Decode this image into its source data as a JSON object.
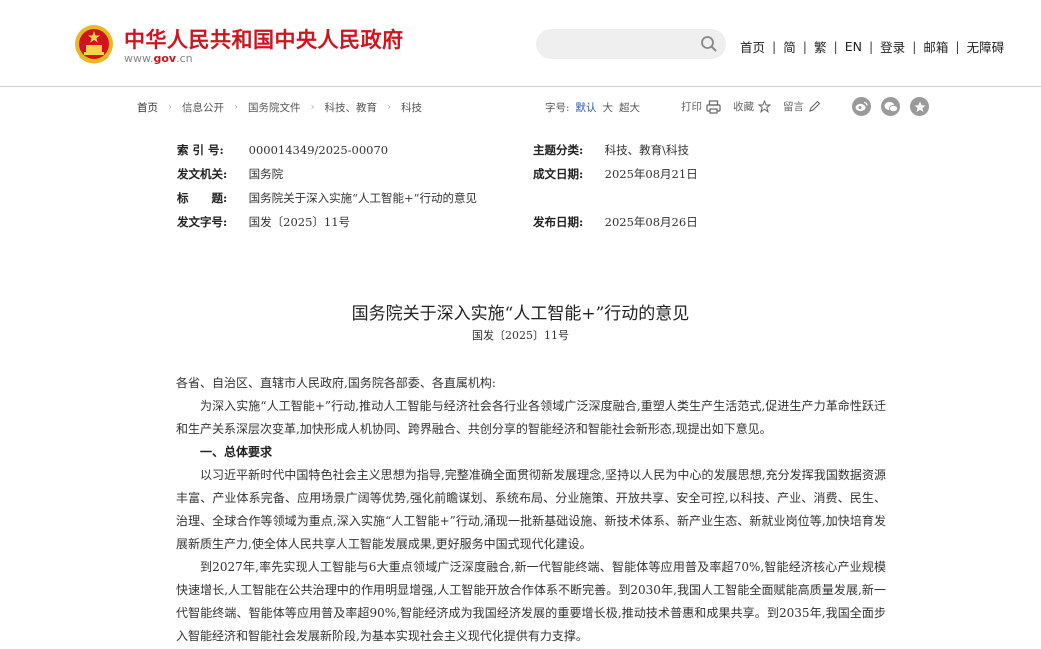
{
  "header": {
    "site_title": "中华人民共和国中央人民政府",
    "site_url_pre": "www.",
    "site_url_bold": "gov",
    "site_url_post": ".cn",
    "nav": [
      "首页",
      "简",
      "繁",
      "EN",
      "登录",
      "邮箱",
      "无障碍"
    ]
  },
  "breadcrumb": [
    "首页",
    "信息公开",
    "国务院文件",
    "科技、教育",
    "科技"
  ],
  "font_size": {
    "label": "字号:",
    "options": [
      "默认",
      "大",
      "超大"
    ],
    "selected": "默认"
  },
  "tools": {
    "print": "打印",
    "favorite": "收藏",
    "comment": "留言"
  },
  "share_icons": [
    "weibo-icon",
    "wechat-icon",
    "star-icon"
  ],
  "meta": {
    "index_label": "索 引 号:",
    "index_value": "000014349/2025-00070",
    "topic_label": "主题分类:",
    "topic_value": "科技、教育\\科技",
    "issuer_label": "发文机关:",
    "issuer_value": "国务院",
    "date_written_label": "成文日期:",
    "date_written_value": "2025年08月21日",
    "title_label": "标　　题:",
    "title_value": "国务院关于深入实施“人工智能+”行动的意见",
    "doc_no_label": "发文字号:",
    "doc_no_value": "国发〔2025〕11号",
    "publish_label": "发布日期:",
    "publish_value": "2025年08月26日"
  },
  "article": {
    "title": "国务院关于深入实施“人工智能+”行动的意见",
    "doc_no": "国发〔2025〕11号",
    "salutation": "各省、自治区、直辖市人民政府,国务院各部委、各直属机构:",
    "para1": "为深入实施“人工智能+”行动,推动人工智能与经济社会各行业各领域广泛深度融合,重塑人类生产生活范式,促进生产力革命性跃迁和生产关系深层次变革,加快形成人机协同、跨界融合、共创分享的智能经济和智能社会新形态,现提出如下意见。",
    "section1": "一、总体要求",
    "para2": "以习近平新时代中国特色社会主义思想为指导,完整准确全面贯彻新发展理念,坚持以人民为中心的发展思想,充分发挥我国数据资源丰富、产业体系完备、应用场景广阔等优势,强化前瞻谋划、系统布局、分业施策、开放共享、安全可控,以科技、产业、消费、民生、治理、全球合作等领域为重点,深入实施“人工智能+”行动,涌现一批新基础设施、新技术体系、新产业生态、新就业岗位等,加快培育发展新质生产力,使全体人民共享人工智能发展成果,更好服务中国式现代化建设。",
    "para3": "到2027年,率先实现人工智能与6大重点领域广泛深度融合,新一代智能终端、智能体等应用普及率超70%,智能经济核心产业规模快速增长,人工智能在公共治理中的作用明显增强,人工智能开放合作体系不断完善。到2030年,我国人工智能全面赋能高质量发展,新一代智能终端、智能体等应用普及率超90%,智能经济成为我国经济发展的重要增长极,推动技术普惠和成果共享。到2035年,我国全面步入智能经济和智能社会发展新阶段,为基本实现社会主义现代化提供有力支撑。"
  },
  "colors": {
    "brand_red": "#d0141e",
    "link_blue": "#2d58a8",
    "rule": "#c9d6e6"
  }
}
